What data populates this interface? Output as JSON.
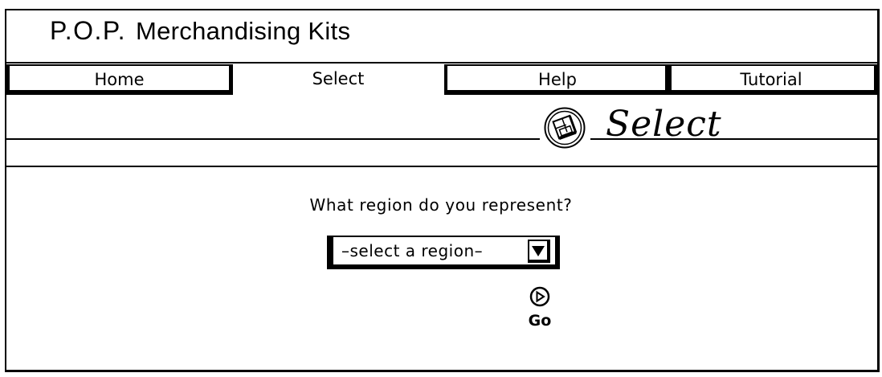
{
  "app": {
    "title_abbr": "P.O.P.",
    "title_rest": "Merchandising Kits"
  },
  "tabs": [
    {
      "label": "Home"
    },
    {
      "label": "Select"
    },
    {
      "label": "Help"
    },
    {
      "label": "Tutorial"
    }
  ],
  "page_heading": {
    "icon": "select-icon",
    "text": "Select"
  },
  "form": {
    "question": "What region do you represent?",
    "region_select_value": "–select a region–",
    "dropdown_icon": "chevron-down-icon",
    "go_icon": "play-circle-icon",
    "go_label": "Go"
  }
}
